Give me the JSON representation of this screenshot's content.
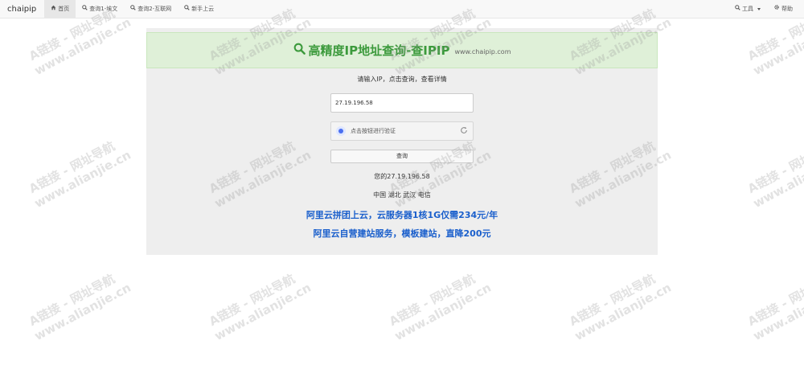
{
  "navbar": {
    "brand": "chaipip",
    "items": [
      {
        "icon": "home-icon",
        "label": "首页",
        "active": true
      },
      {
        "icon": "search-icon",
        "label": "查询1-埃文",
        "active": false
      },
      {
        "icon": "search-icon",
        "label": "查询2-互联网",
        "active": false
      },
      {
        "icon": "search-icon",
        "label": "新手上云",
        "active": false
      }
    ],
    "right": [
      {
        "icon": "search-icon",
        "label": "工具",
        "dropdown": true
      },
      {
        "icon": "gear-icon",
        "label": "帮助",
        "dropdown": false
      }
    ]
  },
  "banner": {
    "title": "高精度IP地址查询-查IPIP",
    "subtitle": "www.chaipip.com"
  },
  "form": {
    "prompt": "请输入IP，点击查询，查看详情",
    "ip_value": "27.19.196.58",
    "captcha_label": "点击按钮进行验证",
    "query_label": "查询"
  },
  "result": {
    "ip_line": "您的27.19.196.58",
    "location": "中国 湖北 武汉 电信"
  },
  "ads": [
    "阿里云拼团上云，云服务器1核1G仅需234元/年",
    "阿里云自营建站服务，模板建站，直降200元"
  ],
  "watermark": {
    "line1": "A链接 - 网址导航",
    "line2": "www.alianjie.cn"
  },
  "colors": {
    "banner_bg": "#dff0d8",
    "banner_text": "#3c9a3c",
    "ad_link": "#1a5fcc",
    "panel_bg": "#eeeeee"
  }
}
